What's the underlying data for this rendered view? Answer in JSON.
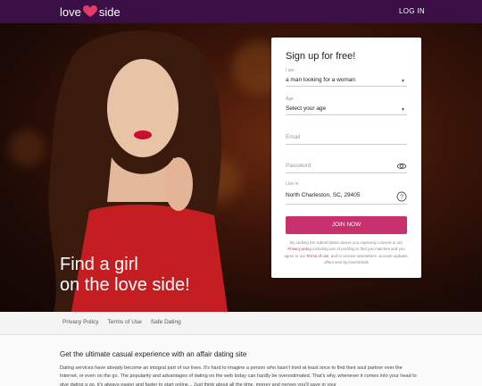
{
  "header": {
    "logo_left": "love",
    "logo_right": "side",
    "login_label": "LOG IN"
  },
  "hero": {
    "title_line1": "Find a girl",
    "title_line2": "on the love side!"
  },
  "form": {
    "title": "Sign up for free!",
    "iam_label": "I am",
    "iam_value": "a man looking for a woman",
    "age_label": "Age",
    "age_value": "Select your age",
    "email_placeholder": "Email",
    "password_placeholder": "Password",
    "livein_label": "Live in",
    "livein_value": "North Charleston, SC, 29405",
    "join_label": "JOIN NOW",
    "terms_part1": "By clicking the submit button above you expressly consent to our",
    "privacy_link": "Privacy policy",
    "terms_part2": "including use of profiling to find you matches and you agree to our",
    "terms_link": "Terms of use",
    "terms_part3": ", and to receive newsletters, account updates, offers sent by loveOnSide"
  },
  "footer": {
    "links": [
      "Privacy Policy",
      "Terms of Use",
      "Safe Dating"
    ]
  },
  "article": {
    "heading": "Get the ultimate casual experience with an affair dating site",
    "body": "Dating services have already become an integral part of our lives. It's hard to imagine a person who hasn't tried at least once to find their soul partner over the Internet, or even on the go. The popularity and advantages of dating on the web today can hardly be overestimated. That's why, whenever it comes into your head to give dating a go, it's always easier and faster to start online... Just think about all the time, money and nerves you'll save in your"
  },
  "colors": {
    "topbar": "#3a0f45",
    "accent": "#c8306e"
  }
}
